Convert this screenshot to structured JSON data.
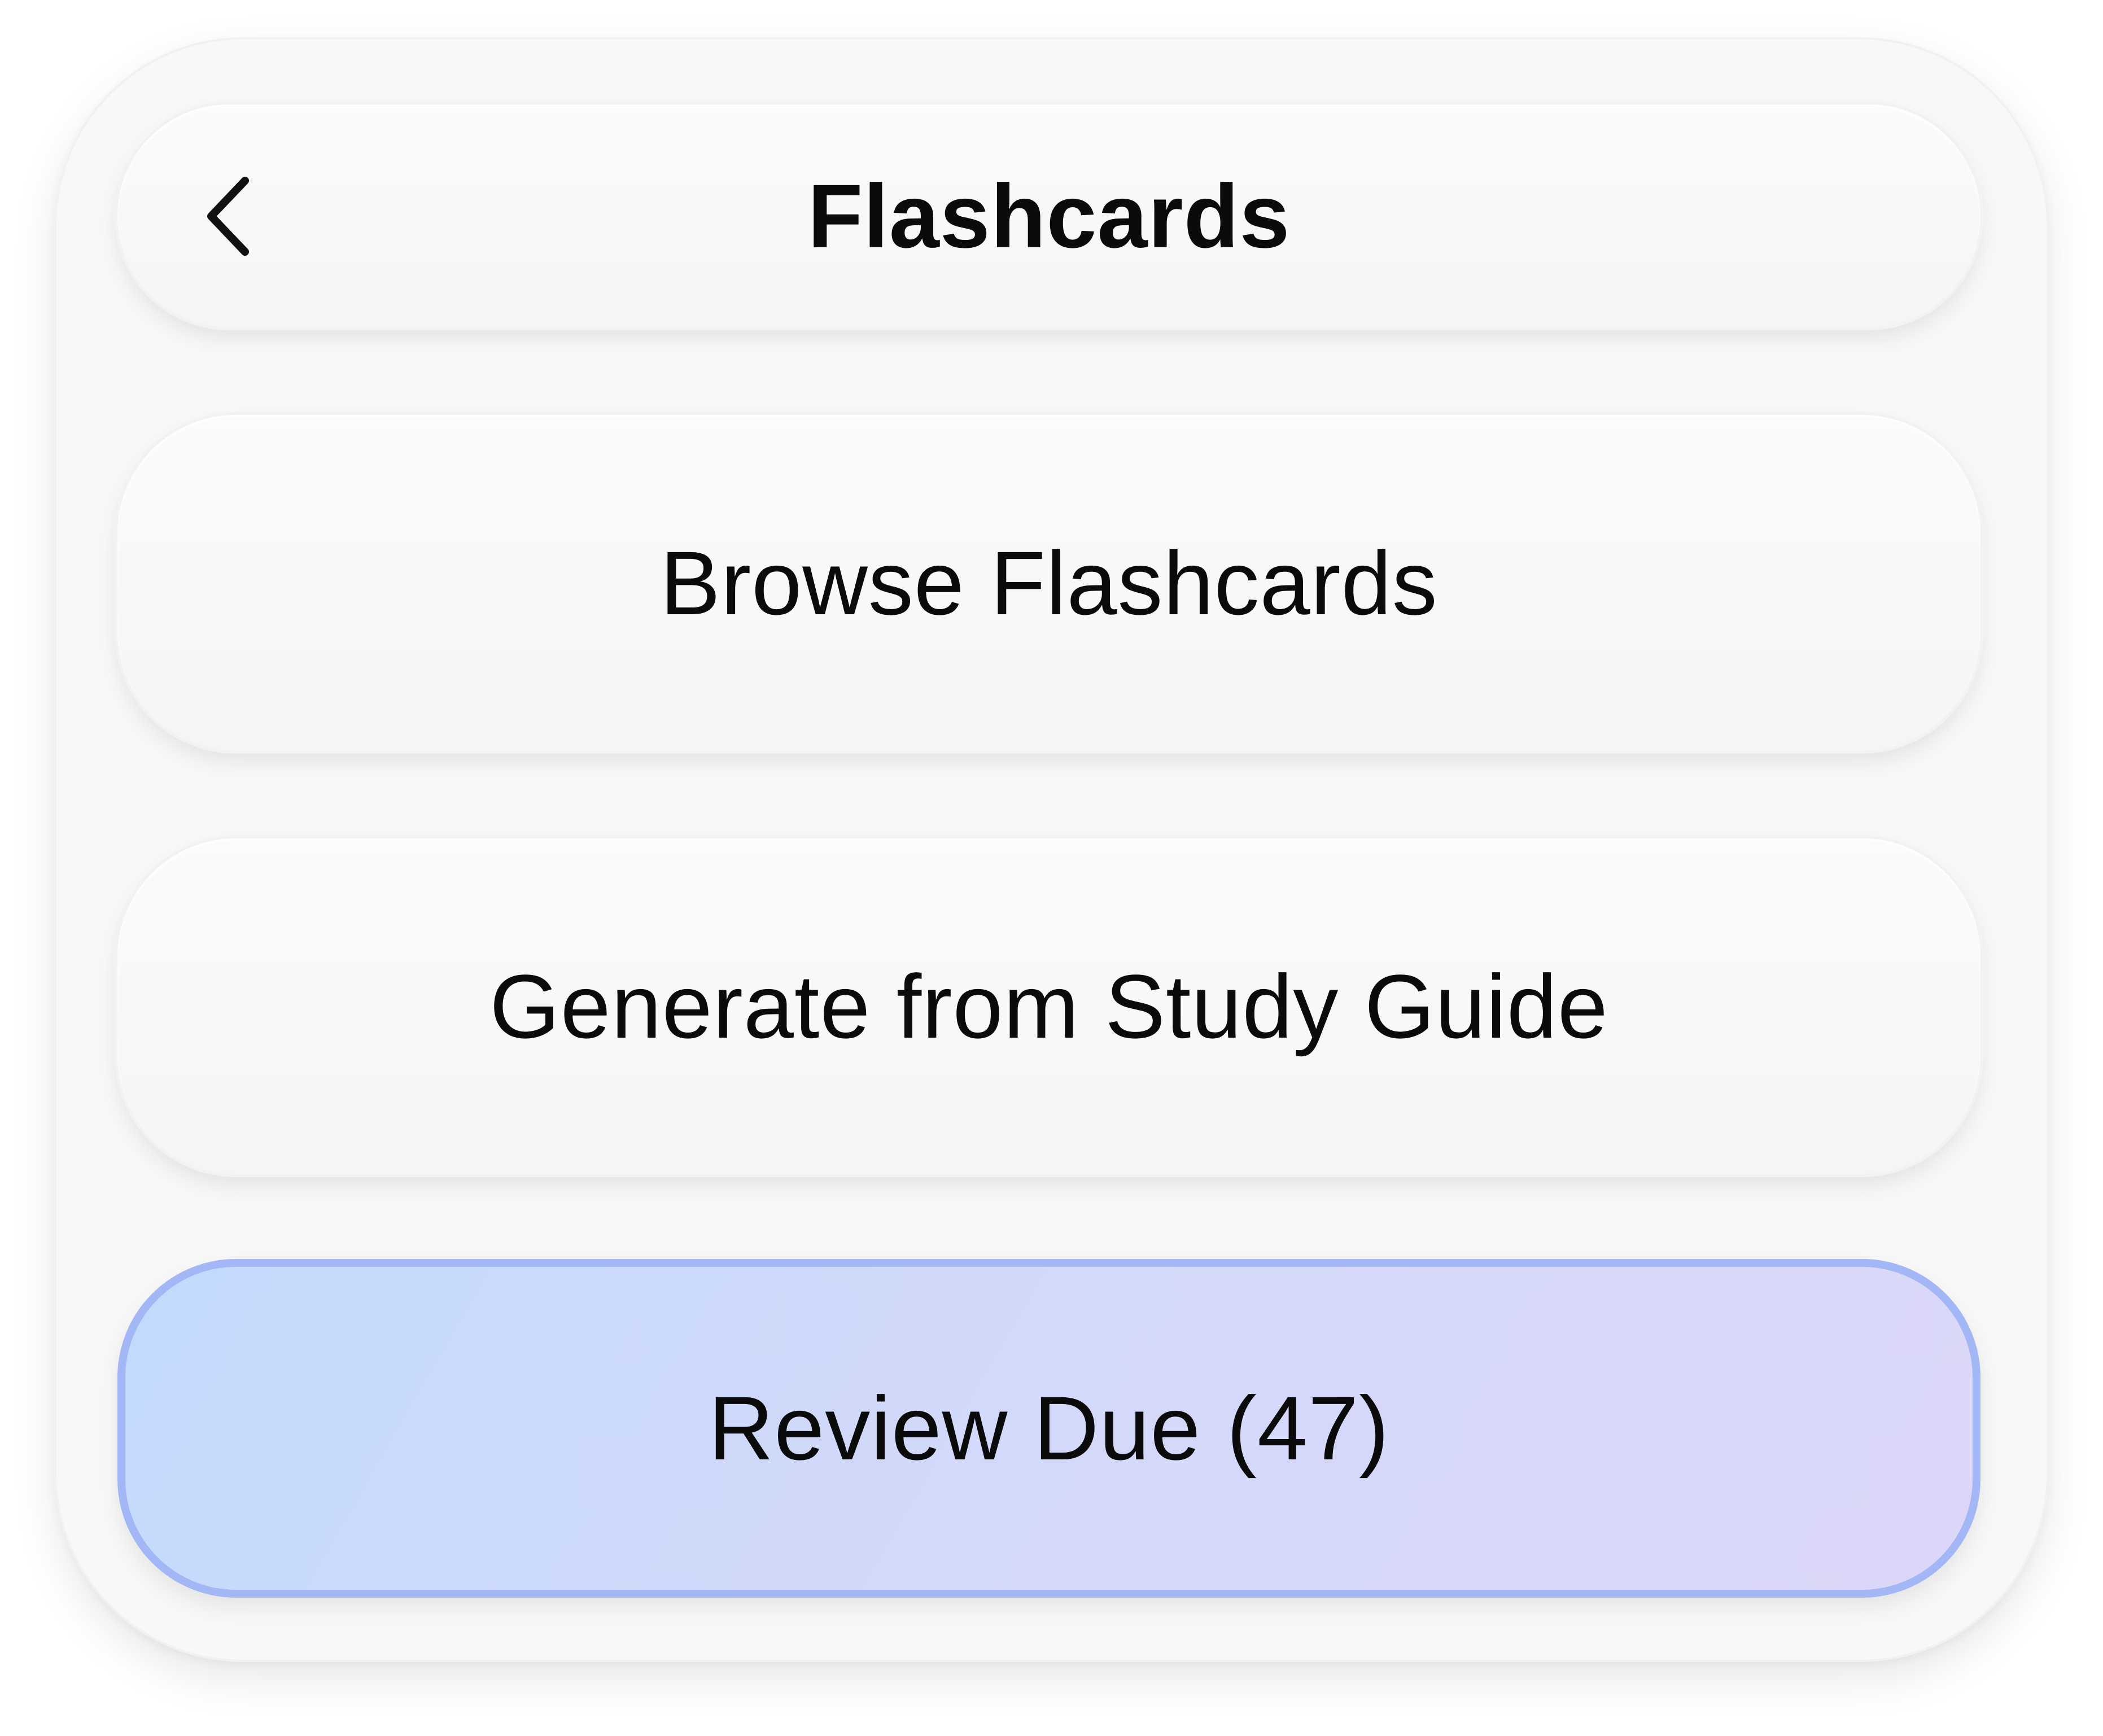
{
  "header": {
    "title": "Flashcards",
    "back_icon": "chevron-left-icon"
  },
  "actions": [
    {
      "label": "Browse Flashcards"
    },
    {
      "label": "Generate from Study Guide"
    },
    {
      "label": "Review Due (47)"
    }
  ],
  "colors": {
    "card_background": "#f8f8f8",
    "button_background": "#f7f7f7",
    "highlight_gradient_start": "#c3dafc",
    "highlight_gradient_end": "#dcd7f8",
    "highlight_border": "#a3b6f6",
    "text": "#0b0b0b"
  }
}
